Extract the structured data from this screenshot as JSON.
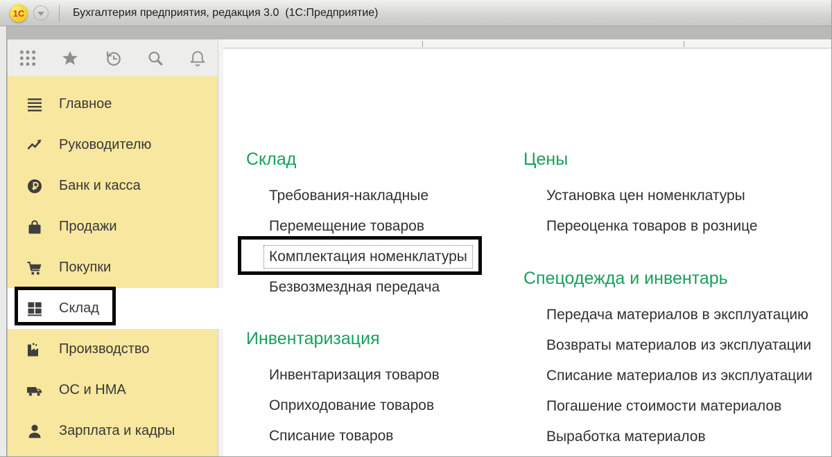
{
  "window": {
    "title": "Бухгалтерия предприятия, редакция 3.0  (1С:Предприятие)",
    "logo_text": "1С"
  },
  "colors": {
    "accent_green": "#18a05c",
    "sidebar_yellow": "#f8e79f",
    "selection_white": "#ffffff",
    "annotation_black": "#070707",
    "titlebar_gray": "#d6d6d4"
  },
  "toolbar": {
    "icons": [
      {
        "name": "apps-grid-icon"
      },
      {
        "name": "favorites-star-icon"
      },
      {
        "name": "history-icon"
      },
      {
        "name": "search-icon"
      },
      {
        "name": "notifications-bell-icon"
      }
    ]
  },
  "tabstrip": {
    "tabs": [
      {
        "label": ""
      },
      {
        "label": ""
      },
      {
        "label": ""
      }
    ]
  },
  "sidebar": {
    "items": [
      {
        "label": "Главное",
        "icon": "menu-lines-icon",
        "selected": false
      },
      {
        "label": "Руководителю",
        "icon": "trend-chart-icon",
        "selected": false
      },
      {
        "label": "Банк и касса",
        "icon": "ruble-icon",
        "selected": false
      },
      {
        "label": "Продажи",
        "icon": "shopping-bag-icon",
        "selected": false
      },
      {
        "label": "Покупки",
        "icon": "shopping-cart-icon",
        "selected": false
      },
      {
        "label": "Склад",
        "icon": "warehouse-icon",
        "selected": true,
        "annotated": true
      },
      {
        "label": "Производство",
        "icon": "factory-icon",
        "selected": false
      },
      {
        "label": "ОС и НМА",
        "icon": "truck-icon",
        "selected": false
      },
      {
        "label": "Зарплата и кадры",
        "icon": "person-icon",
        "selected": false
      }
    ]
  },
  "main": {
    "columns": [
      {
        "sections": [
          {
            "title": "Склад",
            "items": [
              {
                "label": "Требования-накладные"
              },
              {
                "label": "Перемещение товаров"
              },
              {
                "label": "Комплектация номенклатуры",
                "annotated": true,
                "focused": true
              },
              {
                "label": "Безвозмездная передача"
              }
            ]
          },
          {
            "title": "Инвентаризация",
            "items": [
              {
                "label": "Инвентаризация товаров"
              },
              {
                "label": "Оприходование товаров"
              },
              {
                "label": "Списание товаров"
              }
            ]
          }
        ]
      },
      {
        "sections": [
          {
            "title": "Цены",
            "items": [
              {
                "label": "Установка цен номенклатуры"
              },
              {
                "label": "Переоценка товаров в рознице"
              }
            ]
          },
          {
            "title": "Спецодежда и инвентарь",
            "items": [
              {
                "label": "Передача материалов в эксплуатацию"
              },
              {
                "label": "Возвраты материалов из эксплуатации"
              },
              {
                "label": "Списание материалов из эксплуатации"
              },
              {
                "label": "Погашение стоимости материалов"
              },
              {
                "label": "Выработка материалов"
              }
            ]
          }
        ]
      }
    ]
  }
}
